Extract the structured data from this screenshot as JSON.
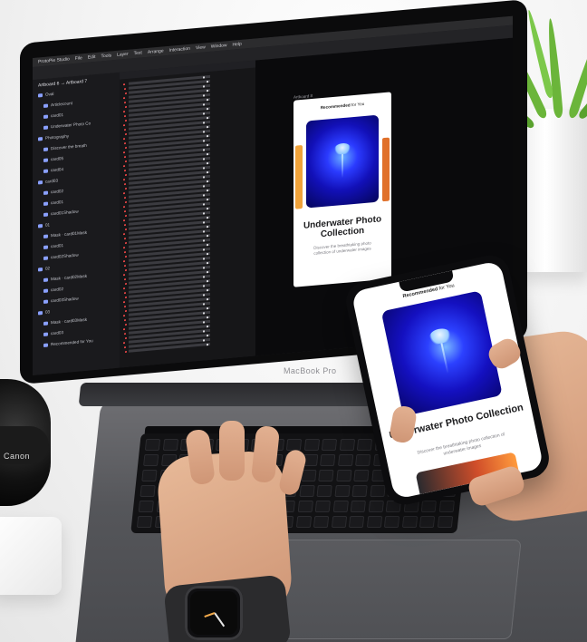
{
  "laptop": {
    "brand": "MacBook Pro",
    "menu": [
      "ProtoPie Studio",
      "File",
      "Edit",
      "Tools",
      "Layer",
      "Text",
      "Arrange",
      "Interaction",
      "View",
      "Window",
      "Help"
    ],
    "artboard_path": "Artboard 6 → Artboard 7",
    "layers": [
      "Oval",
      "Articlecount",
      "card01",
      "Underwater Photo Co",
      "Photography",
      "Discover the breath",
      "card05",
      "card04",
      "card03",
      "card02",
      "card01",
      "card01Shadow",
      "01",
      "Mask · card01Mask",
      "card01",
      "card02Shadow",
      "02",
      "Mask · card02Mask",
      "card02",
      "card03Shadow",
      "03",
      "Mask · card03Mask",
      "card03",
      "Recommended for You"
    ],
    "artboard_label": "Artboard 8",
    "card": {
      "header_bold": "Recommended",
      "header_rest": " for You",
      "title": "Underwater Photo Collection",
      "subtitle": "Discover the breathtaking photo collection of underwater images"
    }
  },
  "phone": {
    "header_bold": "Recommended",
    "header_rest": " for You",
    "title": "Underwater Photo Collection",
    "subtitle": "Discover the breathtaking photo collection of underwater images"
  },
  "lens": {
    "brand": "Canon"
  },
  "colors": {
    "plant_green": "#6bb53a",
    "deep_blue": "#1410c0",
    "timeline_red": "#ff4b4b",
    "canvas_dark": "#0a0a0c"
  },
  "icons": [
    "jellyfish-image",
    "watch-face",
    "layer-icon"
  ]
}
